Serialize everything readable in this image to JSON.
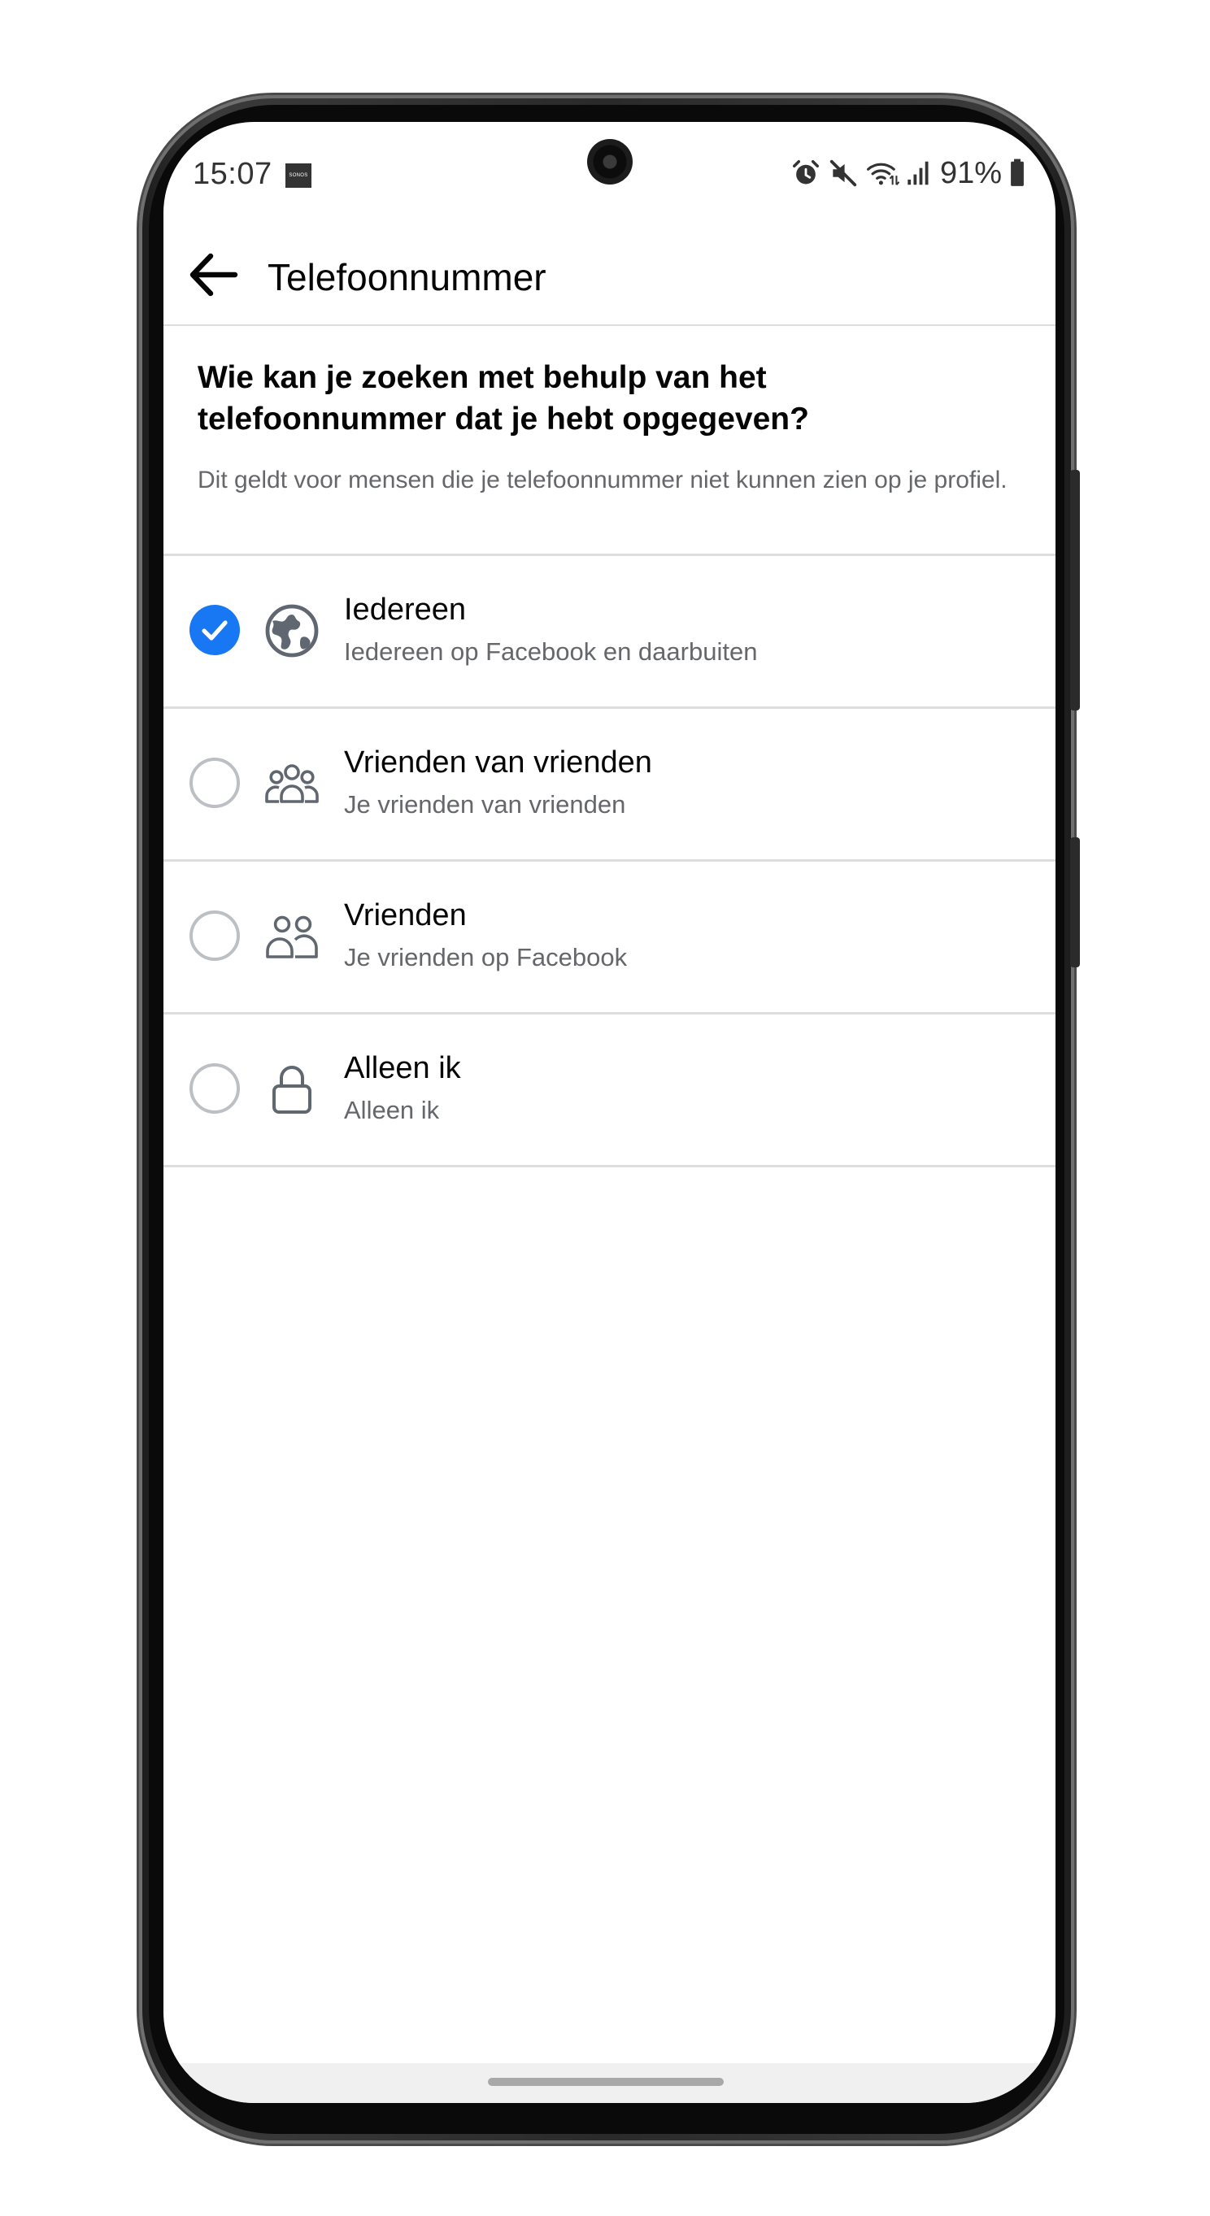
{
  "status_bar": {
    "time": "15:07",
    "sonos_label": "SONOS",
    "battery_percent": "91%",
    "icons": [
      "alarm-icon",
      "mute-icon",
      "wifi-icon",
      "signal-icon",
      "battery-icon"
    ]
  },
  "app_bar": {
    "back_icon": "arrow-left-icon",
    "title": "Telefoonnummer"
  },
  "header": {
    "question": "Wie kan je zoeken met behulp van het telefoonnummer dat je hebt opgegeven?",
    "hint": "Dit geldt voor mensen die je telefoonnummer niet kunnen zien op je profiel."
  },
  "options": [
    {
      "title": "Iedereen",
      "subtitle": "Iedereen op Facebook en daarbuiten",
      "icon": "globe-icon",
      "selected": true
    },
    {
      "title": "Vrienden van vrienden",
      "subtitle": "Je vrienden van vrienden",
      "icon": "friends-of-friends-icon",
      "selected": false
    },
    {
      "title": "Vrienden",
      "subtitle": "Je vrienden op Facebook",
      "icon": "friends-icon",
      "selected": false
    },
    {
      "title": "Alleen ik",
      "subtitle": "Alleen ik",
      "icon": "lock-icon",
      "selected": false
    }
  ],
  "colors": {
    "accent": "#1877f2",
    "primary_text": "#050505",
    "secondary_text": "#65676b",
    "divider": "#dcdde0",
    "radio_border": "#bcc0c4"
  }
}
